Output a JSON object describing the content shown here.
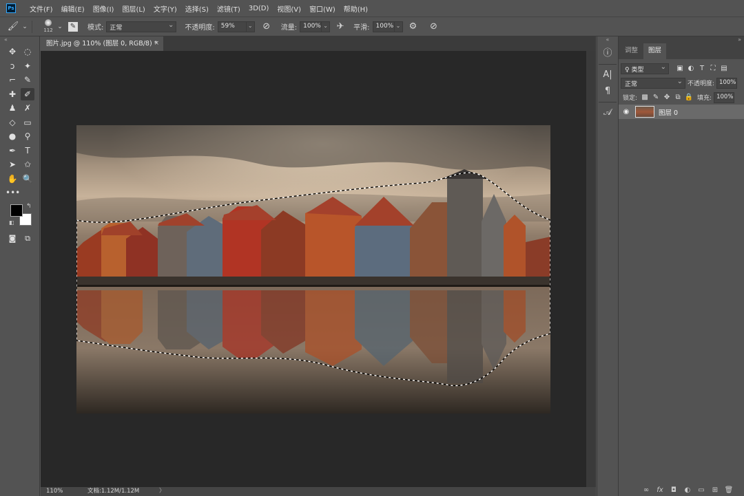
{
  "app": {
    "logo": "Ps"
  },
  "menu": [
    "文件(F)",
    "编辑(E)",
    "图像(I)",
    "图层(L)",
    "文字(Y)",
    "选择(S)",
    "滤镜(T)",
    "3D(D)",
    "视图(V)",
    "窗口(W)",
    "帮助(H)"
  ],
  "options": {
    "brush_size": "112",
    "mode_label": "模式:",
    "mode_value": "正常",
    "opacity_label": "不透明度:",
    "opacity_value": "59%",
    "flow_label": "流量:",
    "flow_value": "100%",
    "smooth_label": "平滑:",
    "smooth_value": "100%"
  },
  "document": {
    "tab_title": "图片.jpg @ 110% (图层 0, RGB/8) *",
    "close": "×"
  },
  "status": {
    "zoom": "110%",
    "doc_info": "文档:1.12M/1.12M",
    "arrow": "〉"
  },
  "tools": [
    [
      "✥",
      "◌"
    ],
    [
      "ↄ",
      "✦"
    ],
    [
      "⌐",
      "✎"
    ],
    [
      "✚",
      "✐"
    ],
    [
      "♟",
      "✗"
    ],
    [
      "◇",
      "▭"
    ],
    [
      "●",
      "⚲"
    ],
    [
      "✒",
      "T"
    ],
    [
      "➤",
      "✩"
    ],
    [
      "✋",
      "🔍"
    ],
    [
      "•••",
      ""
    ]
  ],
  "colors": {
    "foreground": "#000000",
    "background": "#ffffff"
  },
  "mini_dock": {
    "info": "ⓘ",
    "char": "A|",
    "para": "¶",
    "glyph": "𝒜"
  },
  "layers_panel": {
    "tab_adjust": "调整",
    "tab_layers": "图层",
    "filter_kind": "♀ 类型",
    "blend_mode": "正常",
    "opacity_label": "不透明度:",
    "opacity_value": "100%",
    "lock_label": "锁定:",
    "fill_label": "填充:",
    "fill_value": "100%",
    "layer_name": "图层 0"
  },
  "accent": "#31a8ff"
}
